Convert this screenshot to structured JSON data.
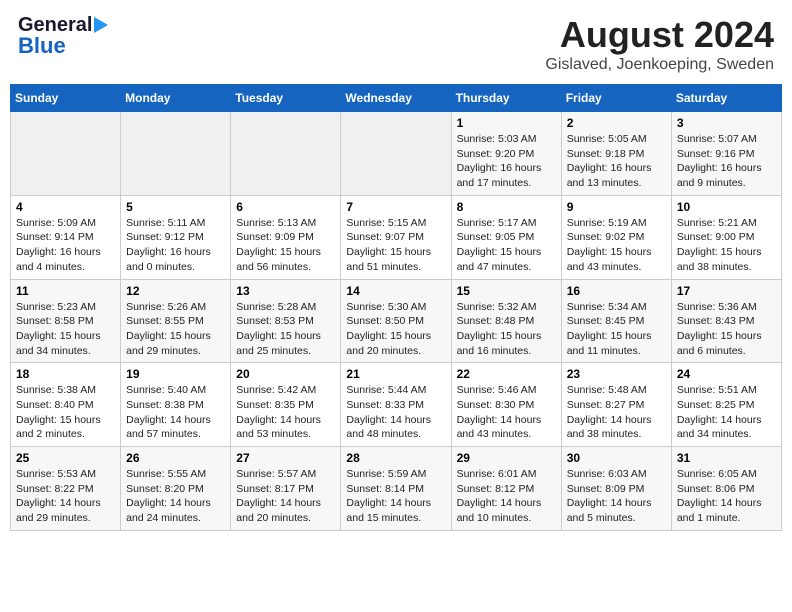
{
  "header": {
    "logo_line1": "General",
    "logo_line2": "Blue",
    "main_title": "August 2024",
    "subtitle": "Gislaved, Joenkoeping, Sweden"
  },
  "days_of_week": [
    "Sunday",
    "Monday",
    "Tuesday",
    "Wednesday",
    "Thursday",
    "Friday",
    "Saturday"
  ],
  "weeks": [
    [
      {
        "day": "",
        "info": ""
      },
      {
        "day": "",
        "info": ""
      },
      {
        "day": "",
        "info": ""
      },
      {
        "day": "",
        "info": ""
      },
      {
        "day": "1",
        "info": "Sunrise: 5:03 AM\nSunset: 9:20 PM\nDaylight: 16 hours\nand 17 minutes."
      },
      {
        "day": "2",
        "info": "Sunrise: 5:05 AM\nSunset: 9:18 PM\nDaylight: 16 hours\nand 13 minutes."
      },
      {
        "day": "3",
        "info": "Sunrise: 5:07 AM\nSunset: 9:16 PM\nDaylight: 16 hours\nand 9 minutes."
      }
    ],
    [
      {
        "day": "4",
        "info": "Sunrise: 5:09 AM\nSunset: 9:14 PM\nDaylight: 16 hours\nand 4 minutes."
      },
      {
        "day": "5",
        "info": "Sunrise: 5:11 AM\nSunset: 9:12 PM\nDaylight: 16 hours\nand 0 minutes."
      },
      {
        "day": "6",
        "info": "Sunrise: 5:13 AM\nSunset: 9:09 PM\nDaylight: 15 hours\nand 56 minutes."
      },
      {
        "day": "7",
        "info": "Sunrise: 5:15 AM\nSunset: 9:07 PM\nDaylight: 15 hours\nand 51 minutes."
      },
      {
        "day": "8",
        "info": "Sunrise: 5:17 AM\nSunset: 9:05 PM\nDaylight: 15 hours\nand 47 minutes."
      },
      {
        "day": "9",
        "info": "Sunrise: 5:19 AM\nSunset: 9:02 PM\nDaylight: 15 hours\nand 43 minutes."
      },
      {
        "day": "10",
        "info": "Sunrise: 5:21 AM\nSunset: 9:00 PM\nDaylight: 15 hours\nand 38 minutes."
      }
    ],
    [
      {
        "day": "11",
        "info": "Sunrise: 5:23 AM\nSunset: 8:58 PM\nDaylight: 15 hours\nand 34 minutes."
      },
      {
        "day": "12",
        "info": "Sunrise: 5:26 AM\nSunset: 8:55 PM\nDaylight: 15 hours\nand 29 minutes."
      },
      {
        "day": "13",
        "info": "Sunrise: 5:28 AM\nSunset: 8:53 PM\nDaylight: 15 hours\nand 25 minutes."
      },
      {
        "day": "14",
        "info": "Sunrise: 5:30 AM\nSunset: 8:50 PM\nDaylight: 15 hours\nand 20 minutes."
      },
      {
        "day": "15",
        "info": "Sunrise: 5:32 AM\nSunset: 8:48 PM\nDaylight: 15 hours\nand 16 minutes."
      },
      {
        "day": "16",
        "info": "Sunrise: 5:34 AM\nSunset: 8:45 PM\nDaylight: 15 hours\nand 11 minutes."
      },
      {
        "day": "17",
        "info": "Sunrise: 5:36 AM\nSunset: 8:43 PM\nDaylight: 15 hours\nand 6 minutes."
      }
    ],
    [
      {
        "day": "18",
        "info": "Sunrise: 5:38 AM\nSunset: 8:40 PM\nDaylight: 15 hours\nand 2 minutes."
      },
      {
        "day": "19",
        "info": "Sunrise: 5:40 AM\nSunset: 8:38 PM\nDaylight: 14 hours\nand 57 minutes."
      },
      {
        "day": "20",
        "info": "Sunrise: 5:42 AM\nSunset: 8:35 PM\nDaylight: 14 hours\nand 53 minutes."
      },
      {
        "day": "21",
        "info": "Sunrise: 5:44 AM\nSunset: 8:33 PM\nDaylight: 14 hours\nand 48 minutes."
      },
      {
        "day": "22",
        "info": "Sunrise: 5:46 AM\nSunset: 8:30 PM\nDaylight: 14 hours\nand 43 minutes."
      },
      {
        "day": "23",
        "info": "Sunrise: 5:48 AM\nSunset: 8:27 PM\nDaylight: 14 hours\nand 38 minutes."
      },
      {
        "day": "24",
        "info": "Sunrise: 5:51 AM\nSunset: 8:25 PM\nDaylight: 14 hours\nand 34 minutes."
      }
    ],
    [
      {
        "day": "25",
        "info": "Sunrise: 5:53 AM\nSunset: 8:22 PM\nDaylight: 14 hours\nand 29 minutes."
      },
      {
        "day": "26",
        "info": "Sunrise: 5:55 AM\nSunset: 8:20 PM\nDaylight: 14 hours\nand 24 minutes."
      },
      {
        "day": "27",
        "info": "Sunrise: 5:57 AM\nSunset: 8:17 PM\nDaylight: 14 hours\nand 20 minutes."
      },
      {
        "day": "28",
        "info": "Sunrise: 5:59 AM\nSunset: 8:14 PM\nDaylight: 14 hours\nand 15 minutes."
      },
      {
        "day": "29",
        "info": "Sunrise: 6:01 AM\nSunset: 8:12 PM\nDaylight: 14 hours\nand 10 minutes."
      },
      {
        "day": "30",
        "info": "Sunrise: 6:03 AM\nSunset: 8:09 PM\nDaylight: 14 hours\nand 5 minutes."
      },
      {
        "day": "31",
        "info": "Sunrise: 6:05 AM\nSunset: 8:06 PM\nDaylight: 14 hours\nand 1 minute."
      }
    ]
  ]
}
